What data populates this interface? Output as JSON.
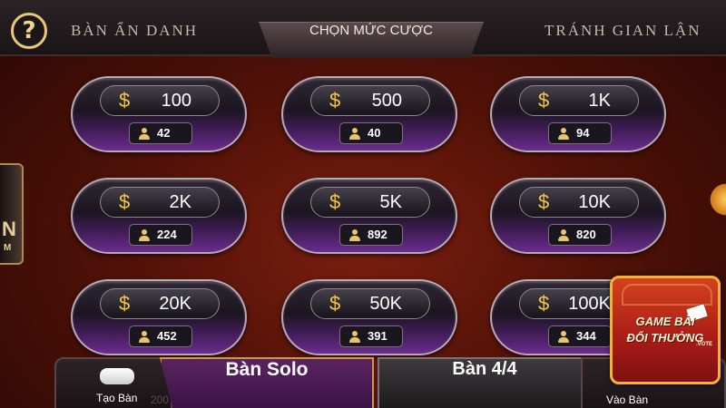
{
  "header": {
    "help_symbol": "?",
    "tab_left": "BÀN ẨN DANH",
    "tab_center": "CHỌN MỨC CƯỢC",
    "tab_right": "TRÁNH GIAN LẬN"
  },
  "currency_symbol": "$",
  "bets": [
    {
      "amount": "100",
      "players": "42"
    },
    {
      "amount": "500",
      "players": "40"
    },
    {
      "amount": "1K",
      "players": "94"
    },
    {
      "amount": "2K",
      "players": "224"
    },
    {
      "amount": "5K",
      "players": "892"
    },
    {
      "amount": "10K",
      "players": "820"
    },
    {
      "amount": "20K",
      "players": "452"
    },
    {
      "amount": "50K",
      "players": "391"
    },
    {
      "amount": "100K",
      "players": "344"
    }
  ],
  "side": {
    "left_big": "N",
    "left_small": "M"
  },
  "bottom": {
    "tao_ban": "Tạo Bàn",
    "tao_ban_ghost": "200",
    "ban_solo": "Bàn Solo",
    "ban_44": "Bàn 4/4",
    "vao_ban": "Vào Bàn"
  },
  "logo": {
    "line1": "GAME BÀI",
    "line2": "ĐỔI THƯỞNG",
    "tag": ".VOTE"
  },
  "colors": {
    "gold": "#f5c542",
    "purple": "#6a2c8c",
    "background_red": "#7a1e10"
  }
}
